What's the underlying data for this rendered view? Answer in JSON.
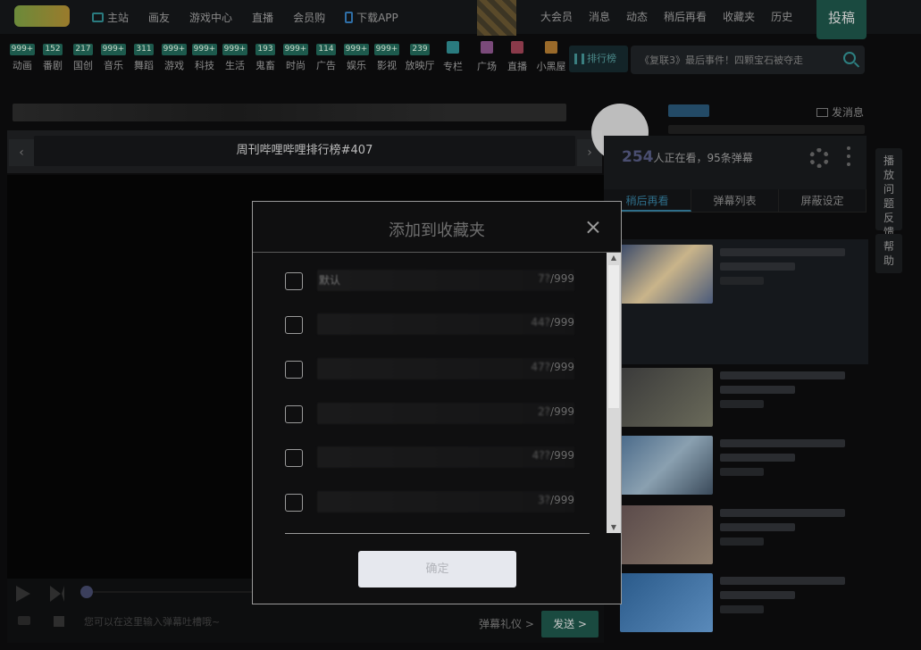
{
  "nav": {
    "left_items": [
      {
        "label": "主站",
        "icon": "tv-icon"
      },
      {
        "label": "画友",
        "icon": ""
      },
      {
        "label": "游戏中心",
        "icon": ""
      },
      {
        "label": "直播",
        "icon": ""
      },
      {
        "label": "会员购",
        "icon": ""
      },
      {
        "label": "下载APP",
        "icon": "phone-icon"
      }
    ],
    "right_items": [
      "大会员",
      "消息",
      "动态",
      "稍后再看",
      "收藏夹",
      "历史"
    ],
    "post_label": "投稿"
  },
  "categories": [
    {
      "badge": "999+",
      "label": "动画"
    },
    {
      "badge": "152",
      "label": "番剧"
    },
    {
      "badge": "217",
      "label": "国创"
    },
    {
      "badge": "999+",
      "label": "音乐"
    },
    {
      "badge": "311",
      "label": "舞蹈"
    },
    {
      "badge": "999+",
      "label": "游戏"
    },
    {
      "badge": "999+",
      "label": "科技"
    },
    {
      "badge": "999+",
      "label": "生活"
    },
    {
      "badge": "193",
      "label": "鬼畜"
    },
    {
      "badge": "999+",
      "label": "时尚"
    },
    {
      "badge": "114",
      "label": "广告"
    },
    {
      "badge": "999+",
      "label": "娱乐"
    },
    {
      "badge": "999+",
      "label": "影视"
    },
    {
      "badge": "239",
      "label": "放映厅"
    }
  ],
  "icon_categories": [
    {
      "label": "专栏",
      "icon": "column-icon",
      "color": "#2a7b7f"
    },
    {
      "label": "广场",
      "icon": "signpost-icon",
      "color": "#7a4a7a"
    },
    {
      "label": "直播",
      "icon": "live-icon",
      "color": "#8a3a4a"
    },
    {
      "label": "小黑屋",
      "icon": "scales-icon",
      "color": "#9a6a2a"
    }
  ],
  "ranking_label": "排行榜",
  "search": {
    "placeholder": "《复联3》最后事件！四颗宝石被夺走"
  },
  "playlist": {
    "title": "周刊哔哩哔哩排行榜#407"
  },
  "uploader": {
    "message_label": "发消息"
  },
  "danmaku": {
    "viewers": "254",
    "viewers_suffix": "人正在看，95条弹幕",
    "tabs": [
      "稍后再看",
      "弹幕列表",
      "屏蔽设定"
    ]
  },
  "side_buttons": {
    "feedback": "播放问题反馈",
    "help": "帮助"
  },
  "controls": {
    "input_placeholder": "您可以在这里输入弹幕吐槽哦~",
    "gift_label": "弹幕礼仪 >",
    "send_label": "发送 >"
  },
  "modal": {
    "title": "添加到收藏夹",
    "folders": [
      {
        "name": "默认",
        "used": "7?",
        "limit": "/999"
      },
      {
        "name": "",
        "used": "44?",
        "limit": "/999"
      },
      {
        "name": "",
        "used": "47?",
        "limit": "/999"
      },
      {
        "name": "",
        "used": "2?",
        "limit": "/999"
      },
      {
        "name": "",
        "used": "4??",
        "limit": "/999"
      },
      {
        "name": "",
        "used": "3?",
        "limit": "/999"
      }
    ],
    "confirm_label": "确定"
  },
  "colors": {
    "accent": "#1a4a40",
    "badge": "#1d5a4d",
    "tab_active": "#2e6e8a"
  }
}
